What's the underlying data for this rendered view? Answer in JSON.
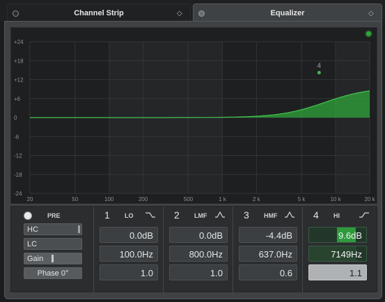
{
  "tabs": [
    {
      "label": "Channel Strip",
      "active": false
    },
    {
      "label": "Equalizer",
      "active": true
    }
  ],
  "graph": {
    "db_labels": [
      "+24",
      "+18",
      "+12",
      "+6",
      "0",
      "-6",
      "-12",
      "-18",
      "-24"
    ],
    "freq_labels": [
      "20",
      "50",
      "100",
      "200",
      "500",
      "1 k",
      "2 k",
      "5 k",
      "10 k",
      "20 k"
    ],
    "freq_values": [
      20,
      50,
      100,
      200,
      500,
      1000,
      2000,
      5000,
      10000,
      20000
    ],
    "db_range": [
      -24,
      24
    ],
    "freq_range": [
      20,
      20000
    ],
    "band_marker": {
      "label": "4",
      "freq": 7149,
      "gain": 9.6
    },
    "colors": {
      "curve": "#2fa63a",
      "background": "#1e1f20"
    }
  },
  "pre": {
    "label": "PRE",
    "hc_label": "HC",
    "lc_label": "LC",
    "gain_label": "Gain",
    "phase_label": "Phase 0°"
  },
  "bands": [
    {
      "num": "1",
      "name": "LO",
      "gain": "0.0dB",
      "freq": "100.0Hz",
      "q": "1.0",
      "shape": "lowshelf"
    },
    {
      "num": "2",
      "name": "LMF",
      "gain": "0.0dB",
      "freq": "800.0Hz",
      "q": "1.0",
      "shape": "peak"
    },
    {
      "num": "3",
      "name": "HMF",
      "gain": "-4.4dB",
      "freq": "637.0Hz",
      "q": "0.6",
      "shape": "peak"
    },
    {
      "num": "4",
      "name": "HI",
      "gain": "9.6dB",
      "freq": "7149Hz",
      "q": "1.1",
      "shape": "highshelf",
      "active": true
    }
  ]
}
